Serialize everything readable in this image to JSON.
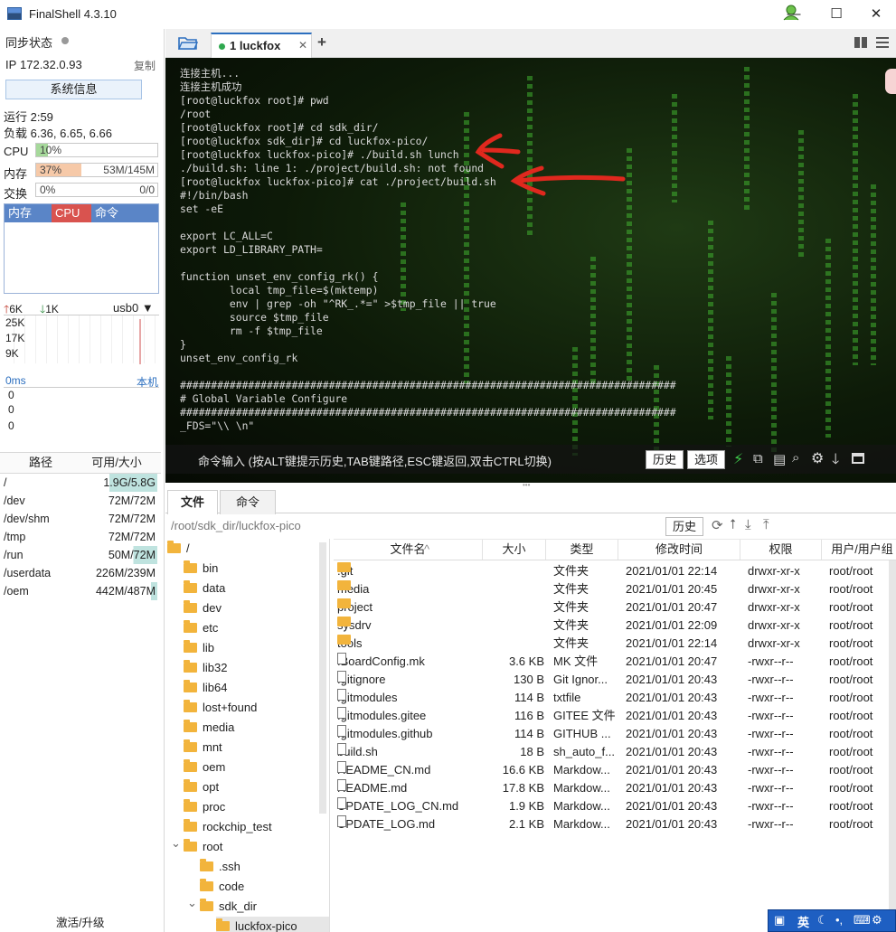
{
  "window": {
    "title": "FinalShell 4.3.10",
    "minimize": "—",
    "maximize": "☐",
    "close": "✕"
  },
  "sidebar": {
    "sync_label": "同步状态",
    "ip_label": "IP",
    "ip_value": "172.32.0.93",
    "copy": "复制",
    "sysinfo_button": "系统信息",
    "uptime": "运行 2:59",
    "load": "负载 6.36, 6.65, 6.66",
    "cpu": {
      "label": "CPU",
      "percent": "10%",
      "fraction": 0.1
    },
    "mem": {
      "label": "内存",
      "percent": "37%",
      "used": "53M/145M",
      "fraction": 0.37
    },
    "swap": {
      "label": "交换",
      "percent": "0%",
      "used": "0/0",
      "fraction": 0.0
    },
    "proc_tabs": [
      "内存",
      "CPU",
      "命令"
    ],
    "net": {
      "up": "6K",
      "down": "1K",
      "iface": "usb0",
      "ticks": [
        "25K",
        "17K",
        "9K"
      ]
    },
    "latency": {
      "value": "0ms",
      "host": "本机",
      "ticks": [
        "0",
        "0",
        "0"
      ]
    },
    "disk_headers": [
      "路径",
      "可用/大小"
    ],
    "disks": [
      {
        "path": "/",
        "size": "1.9G/5.8G"
      },
      {
        "path": "/dev",
        "size": "72M/72M"
      },
      {
        "path": "/dev/shm",
        "size": "72M/72M"
      },
      {
        "path": "/tmp",
        "size": "72M/72M"
      },
      {
        "path": "/run",
        "size": "50M/72M"
      },
      {
        "path": "/userdata",
        "size": "226M/239M"
      },
      {
        "path": "/oem",
        "size": "442M/487M"
      }
    ],
    "activate": "激活/升级"
  },
  "terminal": {
    "tab_label": "1 luckfox",
    "add_tab": "+",
    "lines": [
      "连接主机...",
      "连接主机成功",
      "[root@luckfox root]# pwd",
      "/root",
      "[root@luckfox root]# cd sdk_dir/",
      "[root@luckfox sdk_dir]# cd luckfox-pico/",
      "[root@luckfox luckfox-pico]# ./build.sh lunch",
      "./build.sh: line 1: ./project/build.sh: not found",
      "[root@luckfox luckfox-pico]# cat ./project/build.sh",
      "#!/bin/bash",
      "set -eE",
      "",
      "export LC_ALL=C",
      "export LD_LIBRARY_PATH=",
      "",
      "function unset_env_config_rk() {",
      "        local tmp_file=$(mktemp)",
      "        env | grep -oh \"^RK_.*=\" >$tmp_file || true",
      "        source $tmp_file",
      "        rm -f $tmp_file",
      "}",
      "unset_env_config_rk",
      "",
      "################################################################################",
      "# Global Variable Configure",
      "################################################################################",
      "_FDS=\"\\\\ \\n\""
    ],
    "cmd_hint": "命令输入 (按ALT键提示历史,TAB键路径,ESC键返回,双击CTRL切换)",
    "history_btn": "历史",
    "options_btn": "选项"
  },
  "files": {
    "tabs": [
      "文件",
      "命令"
    ],
    "path": "/root/sdk_dir/luckfox-pico",
    "history_btn": "历史",
    "tree": [
      {
        "name": "/",
        "depth": 0,
        "expanded": true
      },
      {
        "name": "bin",
        "depth": 1
      },
      {
        "name": "data",
        "depth": 1
      },
      {
        "name": "dev",
        "depth": 1
      },
      {
        "name": "etc",
        "depth": 1
      },
      {
        "name": "lib",
        "depth": 1
      },
      {
        "name": "lib32",
        "depth": 1
      },
      {
        "name": "lib64",
        "depth": 1
      },
      {
        "name": "lost+found",
        "depth": 1
      },
      {
        "name": "media",
        "depth": 1
      },
      {
        "name": "mnt",
        "depth": 1
      },
      {
        "name": "oem",
        "depth": 1
      },
      {
        "name": "opt",
        "depth": 1
      },
      {
        "name": "proc",
        "depth": 1
      },
      {
        "name": "rockchip_test",
        "depth": 1
      },
      {
        "name": "root",
        "depth": 1,
        "expanded": true
      },
      {
        "name": ".ssh",
        "depth": 2
      },
      {
        "name": "code",
        "depth": 2
      },
      {
        "name": "sdk_dir",
        "depth": 2,
        "expanded": true
      },
      {
        "name": "luckfox-pico",
        "depth": 3
      }
    ],
    "columns": [
      "文件名",
      "大小",
      "类型",
      "修改时间",
      "权限",
      "用户/用户组"
    ],
    "rows": [
      {
        "name": ".git",
        "size": "",
        "type": "文件夹",
        "mtime": "2021/01/01 22:14",
        "perm": "drwxr-xr-x",
        "owner": "root/root",
        "dir": true
      },
      {
        "name": "media",
        "size": "",
        "type": "文件夹",
        "mtime": "2021/01/01 20:45",
        "perm": "drwxr-xr-x",
        "owner": "root/root",
        "dir": true
      },
      {
        "name": "project",
        "size": "",
        "type": "文件夹",
        "mtime": "2021/01/01 20:47",
        "perm": "drwxr-xr-x",
        "owner": "root/root",
        "dir": true
      },
      {
        "name": "sysdrv",
        "size": "",
        "type": "文件夹",
        "mtime": "2021/01/01 22:09",
        "perm": "drwxr-xr-x",
        "owner": "root/root",
        "dir": true
      },
      {
        "name": "tools",
        "size": "",
        "type": "文件夹",
        "mtime": "2021/01/01 22:14",
        "perm": "drwxr-xr-x",
        "owner": "root/root",
        "dir": true
      },
      {
        "name": ".BoardConfig.mk",
        "size": "3.6 KB",
        "type": "MK 文件",
        "mtime": "2021/01/01 20:47",
        "perm": "-rwxr--r--",
        "owner": "root/root"
      },
      {
        "name": ".gitignore",
        "size": "130 B",
        "type": "Git Ignor...",
        "mtime": "2021/01/01 20:43",
        "perm": "-rwxr--r--",
        "owner": "root/root"
      },
      {
        "name": ".gitmodules",
        "size": "114 B",
        "type": "txtfile",
        "mtime": "2021/01/01 20:43",
        "perm": "-rwxr--r--",
        "owner": "root/root"
      },
      {
        "name": ".gitmodules.gitee",
        "size": "116 B",
        "type": "GITEE 文件",
        "mtime": "2021/01/01 20:43",
        "perm": "-rwxr--r--",
        "owner": "root/root"
      },
      {
        "name": ".gitmodules.github",
        "size": "114 B",
        "type": "GITHUB ...",
        "mtime": "2021/01/01 20:43",
        "perm": "-rwxr--r--",
        "owner": "root/root"
      },
      {
        "name": "build.sh",
        "size": "18 B",
        "type": "sh_auto_f...",
        "mtime": "2021/01/01 20:43",
        "perm": "-rwxr--r--",
        "owner": "root/root"
      },
      {
        "name": "README_CN.md",
        "size": "16.6 KB",
        "type": "Markdow...",
        "mtime": "2021/01/01 20:43",
        "perm": "-rwxr--r--",
        "owner": "root/root"
      },
      {
        "name": "README.md",
        "size": "17.8 KB",
        "type": "Markdow...",
        "mtime": "2021/01/01 20:43",
        "perm": "-rwxr--r--",
        "owner": "root/root"
      },
      {
        "name": "UPDATE_LOG_CN.md",
        "size": "1.9 KB",
        "type": "Markdow...",
        "mtime": "2021/01/01 20:43",
        "perm": "-rwxr--r--",
        "owner": "root/root"
      },
      {
        "name": "UPDATE_LOG.md",
        "size": "2.1 KB",
        "type": "Markdow...",
        "mtime": "2021/01/01 20:43",
        "perm": "-rwxr--r--",
        "owner": "root/root"
      }
    ]
  },
  "ime": {
    "label": "英"
  },
  "colors": {
    "accent": "#5a85c7",
    "cpu_tab": "#d9534f",
    "mem_bar": "#f6c9a8",
    "cpu_bar": "#a6d99b",
    "annotation": "#e0281e"
  }
}
